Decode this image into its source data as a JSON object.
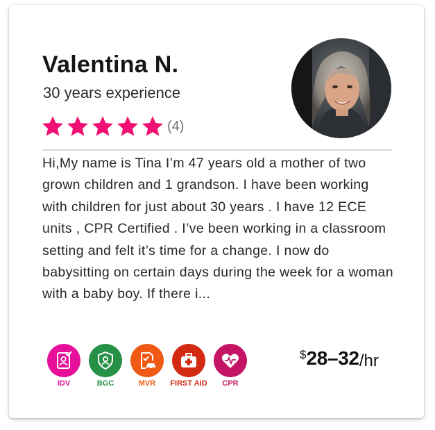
{
  "caregiver": {
    "name": "Valentina N.",
    "experience": "30 years experience",
    "rating_stars": 5,
    "rating_count": "(4)",
    "bio": "Hi,My name is Tina I’m 47 years old a mother of two grown children and 1 grandson. I have been working with children for just about 30 years . I have 12 ECE units , CPR Certified . I’ve been working in a classroom setting and felt it’s time for a change. I now do babysitting on certain days during the week for a woman with a baby boy. If there i..."
  },
  "badges": [
    {
      "label": "IDV",
      "color": "#e6109a",
      "icon": "id-verified-icon"
    },
    {
      "label": "BGC",
      "color": "#279147",
      "icon": "background-check-icon"
    },
    {
      "label": "MVR",
      "color": "#f05a14",
      "icon": "motor-vehicle-record-icon"
    },
    {
      "label": "FIRST AID",
      "color": "#d32a12",
      "icon": "first-aid-kit-icon"
    },
    {
      "label": "CPR",
      "color": "#c41565",
      "icon": "heart-pulse-icon"
    }
  ],
  "price": {
    "currency": "$",
    "range": "28–32",
    "unit": "/hr"
  },
  "colors": {
    "star": "#f00f73",
    "divider": "#d8d8d8"
  }
}
